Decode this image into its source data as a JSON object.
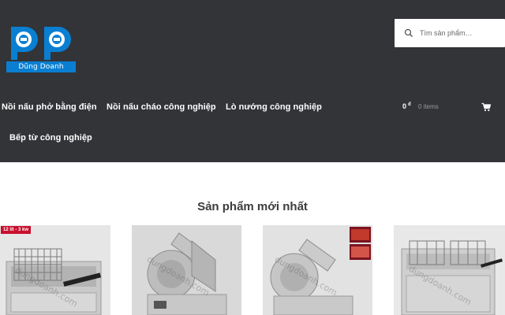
{
  "brand": {
    "name": "Dũng Doanh",
    "primary_color": "#0a7fd2",
    "header_bg": "#333438"
  },
  "search": {
    "placeholder": "Tìm sản phẩm…",
    "icon": "search-icon"
  },
  "nav": {
    "items": [
      {
        "label": "Nồi nấu phở bằng điện"
      },
      {
        "label": "Nồi nấu cháo công nghiệp"
      },
      {
        "label": "Lò nướng công nghiệp"
      },
      {
        "label": "Bếp từ công nghiệp"
      }
    ]
  },
  "cart": {
    "amount": "0",
    "currency": "đ",
    "count_label": "0 items",
    "icon": "cart-icon"
  },
  "main": {
    "section_title": "Sản phẩm mới nhất",
    "products": [
      {
        "badge": "12 lít - 3 kw",
        "watermark": "dungdoanh.com",
        "kind": "fryer"
      },
      {
        "badge": "",
        "watermark": "dungdoanh.com",
        "kind": "slicer"
      },
      {
        "badge": "",
        "watermark": "dungdoanh.com",
        "kind": "slicer"
      },
      {
        "badge": "",
        "watermark": "dungdoanh.com",
        "kind": "fryer"
      }
    ]
  }
}
